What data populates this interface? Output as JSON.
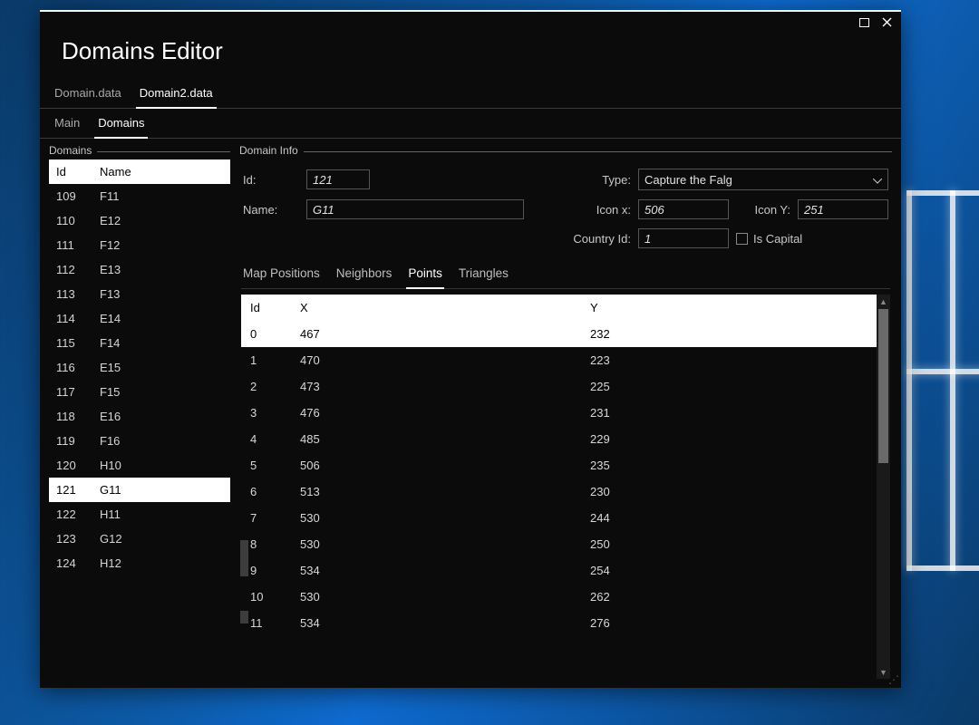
{
  "window": {
    "title": "Domains Editor",
    "file_tabs": [
      "Domain.data",
      "Domain2.data"
    ],
    "file_tab_active_index": 1,
    "page_tabs": [
      "Main",
      "Domains"
    ],
    "page_tab_active_index": 1
  },
  "sidebar": {
    "group_label": "Domains",
    "head_id": "Id",
    "head_name": "Name",
    "selected_id": "121",
    "rows": [
      {
        "id": "109",
        "name": "F11"
      },
      {
        "id": "110",
        "name": "E12"
      },
      {
        "id": "111",
        "name": "F12"
      },
      {
        "id": "112",
        "name": "E13"
      },
      {
        "id": "113",
        "name": "F13"
      },
      {
        "id": "114",
        "name": "E14"
      },
      {
        "id": "115",
        "name": "F14"
      },
      {
        "id": "116",
        "name": "E15"
      },
      {
        "id": "117",
        "name": "F15"
      },
      {
        "id": "118",
        "name": "E16"
      },
      {
        "id": "119",
        "name": "F16"
      },
      {
        "id": "120",
        "name": "H10"
      },
      {
        "id": "121",
        "name": "G11"
      },
      {
        "id": "122",
        "name": "H11"
      },
      {
        "id": "123",
        "name": "G12"
      },
      {
        "id": "124",
        "name": "H12"
      }
    ]
  },
  "info": {
    "group_label": "Domain Info",
    "labels": {
      "id": "Id:",
      "name": "Name:",
      "type": "Type:",
      "iconx": "Icon x:",
      "icony": "Icon Y:",
      "country": "Country Id:",
      "iscapital": "Is Capital"
    },
    "values": {
      "id": "121",
      "name": "G11",
      "type": "Capture the Falg",
      "iconx": "506",
      "icony": "251",
      "country": "1",
      "iscapital_checked": false
    }
  },
  "subtabs": {
    "items": [
      "Map Positions",
      "Neighbors",
      "Points",
      "Triangles"
    ],
    "active_index": 2
  },
  "points": {
    "head": {
      "id": "Id",
      "x": "X",
      "y": "Y"
    },
    "selected_index": 0,
    "rows": [
      {
        "id": "0",
        "x": "467",
        "y": "232"
      },
      {
        "id": "1",
        "x": "470",
        "y": "223"
      },
      {
        "id": "2",
        "x": "473",
        "y": "225"
      },
      {
        "id": "3",
        "x": "476",
        "y": "231"
      },
      {
        "id": "4",
        "x": "485",
        "y": "229"
      },
      {
        "id": "5",
        "x": "506",
        "y": "235"
      },
      {
        "id": "6",
        "x": "513",
        "y": "230"
      },
      {
        "id": "7",
        "x": "530",
        "y": "244"
      },
      {
        "id": "8",
        "x": "530",
        "y": "250"
      },
      {
        "id": "9",
        "x": "534",
        "y": "254"
      },
      {
        "id": "10",
        "x": "530",
        "y": "262"
      },
      {
        "id": "11",
        "x": "534",
        "y": "276"
      }
    ]
  }
}
